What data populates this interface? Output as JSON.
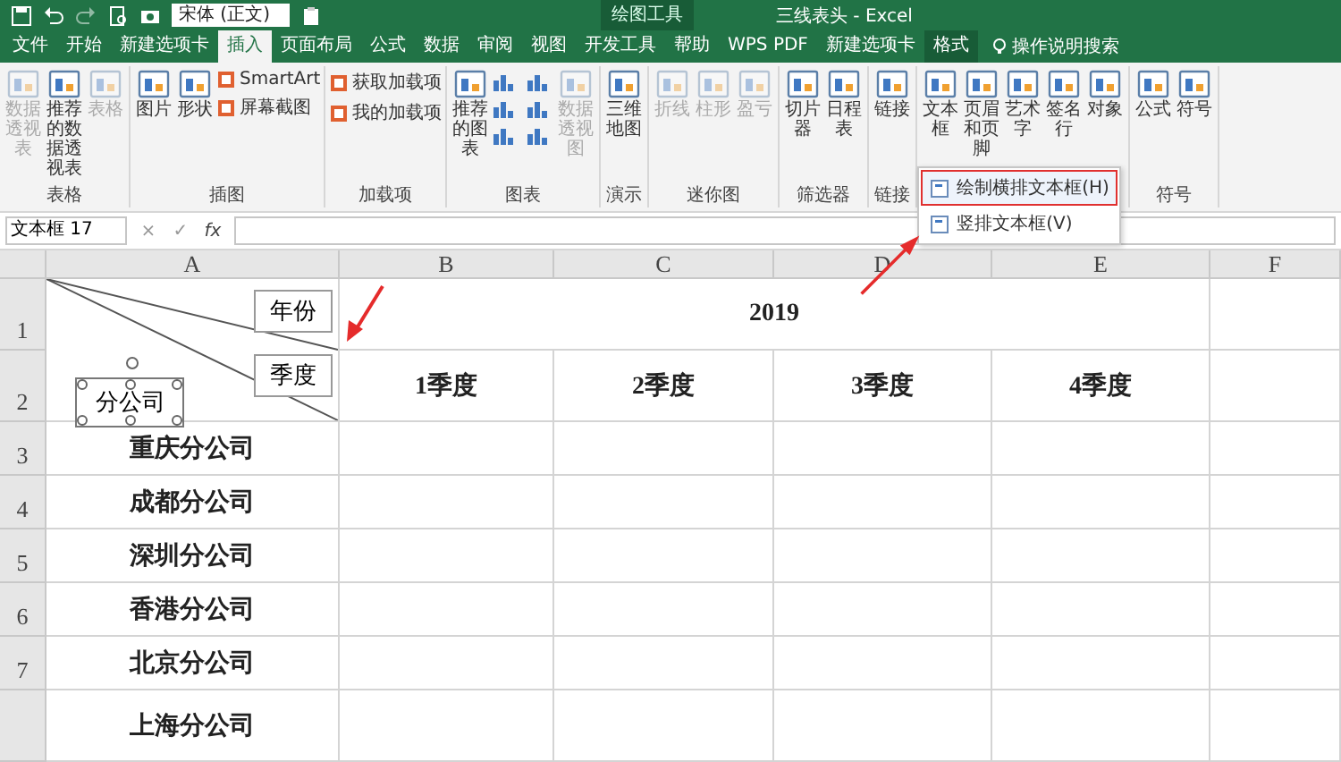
{
  "title_bar": {
    "font_box": "宋体 (正文)",
    "context_label": "绘图工具",
    "title": "三线表头 - Excel"
  },
  "tabs": [
    {
      "label": "文件",
      "selected": false,
      "kind": "normal"
    },
    {
      "label": "开始",
      "selected": false,
      "kind": "normal"
    },
    {
      "label": "新建选项卡",
      "selected": false,
      "kind": "normal"
    },
    {
      "label": "插入",
      "selected": true,
      "kind": "normal"
    },
    {
      "label": "页面布局",
      "selected": false,
      "kind": "normal"
    },
    {
      "label": "公式",
      "selected": false,
      "kind": "normal"
    },
    {
      "label": "数据",
      "selected": false,
      "kind": "normal"
    },
    {
      "label": "审阅",
      "selected": false,
      "kind": "normal"
    },
    {
      "label": "视图",
      "selected": false,
      "kind": "normal"
    },
    {
      "label": "开发工具",
      "selected": false,
      "kind": "normal"
    },
    {
      "label": "帮助",
      "selected": false,
      "kind": "normal"
    },
    {
      "label": "WPS PDF",
      "selected": false,
      "kind": "normal"
    },
    {
      "label": "新建选项卡",
      "selected": false,
      "kind": "normal"
    },
    {
      "label": "格式",
      "selected": false,
      "kind": "context"
    }
  ],
  "tell_me": "操作说明搜索",
  "ribbon_groups": [
    {
      "name": "表格",
      "items": [
        {
          "kind": "large",
          "label": "数据透视表",
          "disabled": true
        },
        {
          "kind": "large",
          "label": "推荐的数据透视表",
          "disabled": false
        },
        {
          "kind": "large",
          "label": "表格",
          "disabled": true
        }
      ]
    },
    {
      "name": "插图",
      "items": [
        {
          "kind": "large",
          "label": "图片",
          "disabled": false
        },
        {
          "kind": "large",
          "label": "形状",
          "disabled": false
        },
        {
          "kind": "small",
          "label": "SmartArt",
          "disabled": false
        },
        {
          "kind": "small",
          "label": "屏幕截图",
          "disabled": false
        }
      ]
    },
    {
      "name": "加载项",
      "items": [
        {
          "kind": "small",
          "label": "获取加载项",
          "disabled": false
        },
        {
          "kind": "small",
          "label": "我的加载项",
          "disabled": false
        }
      ]
    },
    {
      "name": "图表",
      "items": [
        {
          "kind": "large",
          "label": "推荐的图表",
          "disabled": false
        },
        {
          "kind": "icon",
          "disabled": false
        },
        {
          "kind": "icon",
          "disabled": false
        },
        {
          "kind": "icon",
          "disabled": false
        },
        {
          "kind": "icon",
          "disabled": false
        },
        {
          "kind": "icon",
          "disabled": false
        },
        {
          "kind": "icon",
          "disabled": false
        },
        {
          "kind": "large",
          "label": "数据透视图",
          "disabled": true
        }
      ]
    },
    {
      "name": "演示",
      "items": [
        {
          "kind": "large",
          "label": "三维地图",
          "disabled": false
        }
      ]
    },
    {
      "name": "迷你图",
      "items": [
        {
          "kind": "large",
          "label": "折线",
          "disabled": true
        },
        {
          "kind": "large",
          "label": "柱形",
          "disabled": true
        },
        {
          "kind": "large",
          "label": "盈亏",
          "disabled": true
        }
      ]
    },
    {
      "name": "筛选器",
      "items": [
        {
          "kind": "large",
          "label": "切片器",
          "disabled": false
        },
        {
          "kind": "large",
          "label": "日程表",
          "disabled": false
        }
      ]
    },
    {
      "name": "链接",
      "items": [
        {
          "kind": "large",
          "label": "链接",
          "disabled": false
        }
      ]
    },
    {
      "items": [
        {
          "kind": "large",
          "label": "文本框",
          "disabled": false,
          "menu": [
            {
              "label": "绘制横排文本框(H)",
              "selected": true
            },
            {
              "label": "竖排文本框(V)",
              "selected": false
            }
          ]
        },
        {
          "kind": "large",
          "label": "页眉和页脚",
          "disabled": false
        },
        {
          "kind": "large",
          "label": "艺术字",
          "disabled": false
        },
        {
          "kind": "large",
          "label": "签名行",
          "disabled": false
        },
        {
          "kind": "large",
          "label": "对象",
          "disabled": false
        }
      ]
    },
    {
      "name": "符号",
      "items": [
        {
          "kind": "large",
          "label": "公式",
          "disabled": false
        },
        {
          "kind": "large",
          "label": "符号",
          "disabled": false
        }
      ]
    }
  ],
  "formula_bar": {
    "name_box": "文本框 17",
    "cancel": "×",
    "enter": "✓",
    "function": "fx"
  },
  "sheet": {
    "columns": [
      "A",
      "B",
      "C",
      "D",
      "E",
      "F"
    ],
    "row_headers": [
      "1",
      "2",
      "3",
      "4",
      "5",
      "6",
      "7"
    ],
    "corner_textboxes": [
      {
        "text": "年份",
        "selected": false
      },
      {
        "text": "季度",
        "selected": false
      },
      {
        "text": "分公司",
        "selected": true
      }
    ],
    "year": "2019",
    "quarters": [
      "1季度",
      "2季度",
      "3季度",
      "4季度"
    ],
    "companies": [
      "重庆分公司",
      "成都分公司",
      "深圳分公司",
      "香港分公司",
      "北京分公司",
      "上海分公司"
    ]
  }
}
